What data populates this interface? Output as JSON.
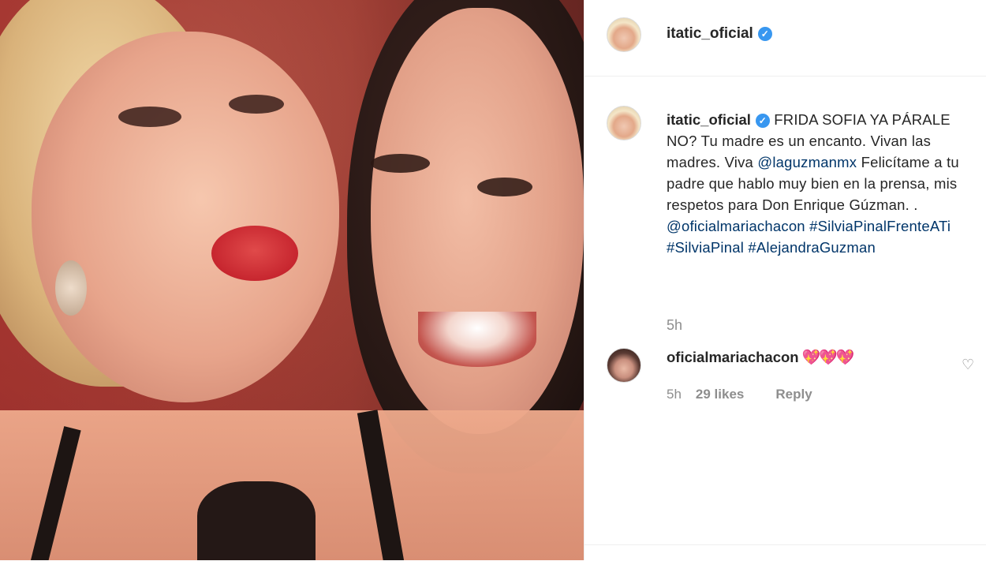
{
  "post": {
    "username": "itatic_oficial",
    "verified_mark": "✓"
  },
  "caption": {
    "username": "itatic_oficial",
    "text_plain_1": "FRIDA SOFIA YA PÁRALE NO? Tu madre es un encanto. Vivan las madres. Viva ",
    "mention_1": "@laguzmanmx",
    "text_plain_2": " Felicítame a tu padre que hablo muy bien en la prensa, mis respetos para Don Enrique Gúzman. . ",
    "mention_2": "@oficialmariachacon",
    "hashtag_1": "#SilviaPinalFrenteATi",
    "hashtag_2": "#SilviaPinal",
    "hashtag_3": "#AlejandraGuzman",
    "time": "5h"
  },
  "comment": {
    "username": "oficialmariachacon",
    "hearts": "💖💖💖",
    "time": "5h",
    "likes": "29 likes",
    "reply": "Reply",
    "like_icon": "♡"
  },
  "colors": {
    "link": "#003569",
    "verified": "#3897f0",
    "muted": "#8e8e8e"
  }
}
